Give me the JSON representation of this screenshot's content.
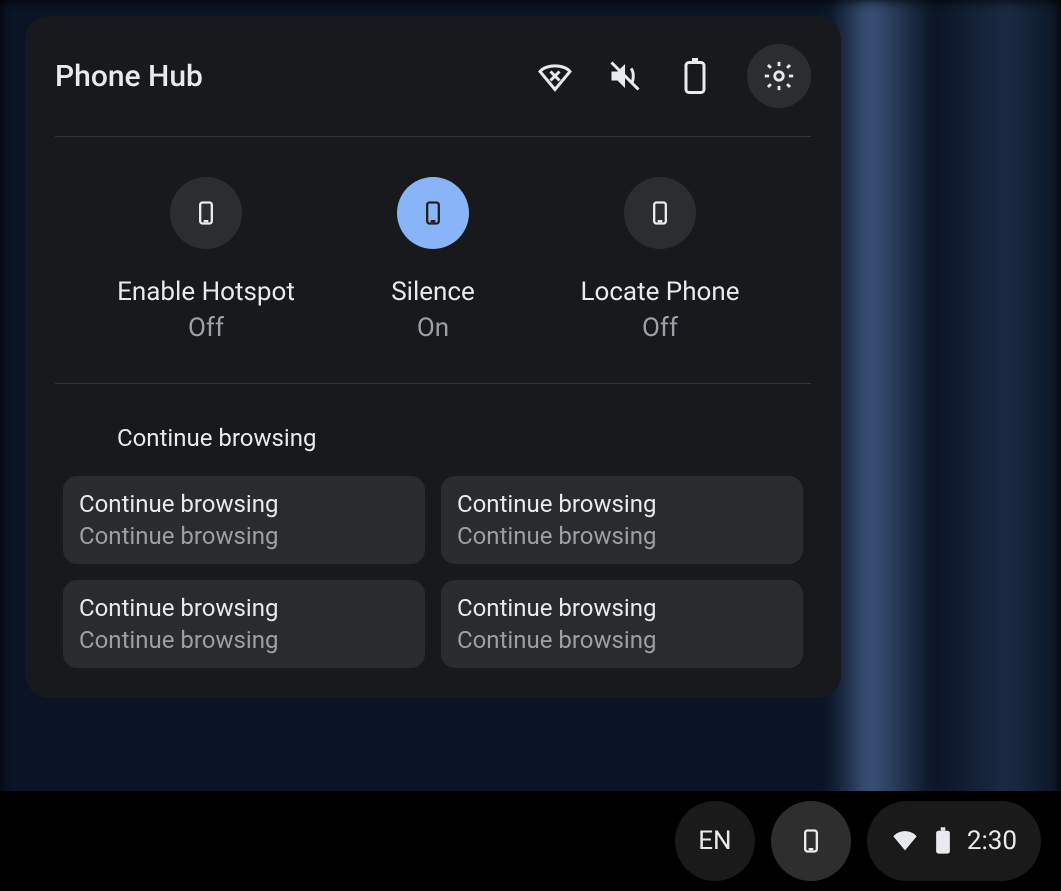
{
  "panel": {
    "title": "Phone Hub"
  },
  "quick_actions": [
    {
      "label": "Enable Hotspot",
      "state": "Off",
      "on": false
    },
    {
      "label": "Silence",
      "state": "On",
      "on": true
    },
    {
      "label": "Locate Phone",
      "state": "Off",
      "on": false
    }
  ],
  "continue_section": {
    "title": "Continue browsing",
    "chips": [
      {
        "title": "Continue browsing",
        "subtitle": "Continue browsing"
      },
      {
        "title": "Continue browsing",
        "subtitle": "Continue browsing"
      },
      {
        "title": "Continue browsing",
        "subtitle": "Continue browsing"
      },
      {
        "title": "Continue browsing",
        "subtitle": "Continue browsing"
      }
    ]
  },
  "shelf": {
    "ime": "EN",
    "clock": "2:30"
  }
}
